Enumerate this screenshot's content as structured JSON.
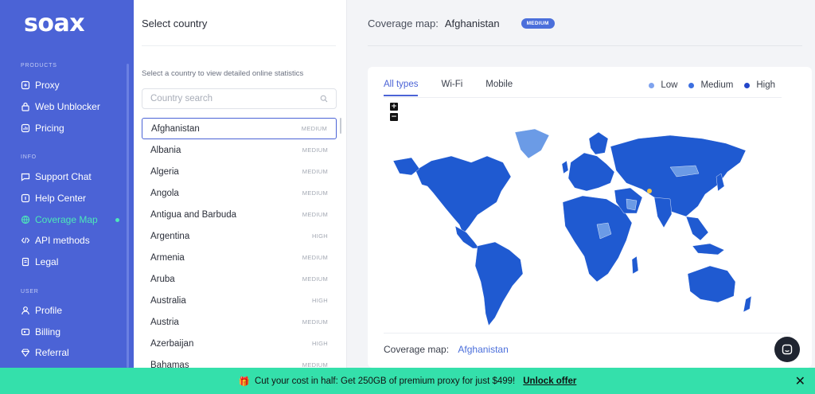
{
  "brand": {
    "logo": "soax"
  },
  "sidebar": {
    "sections": {
      "products": "PRODUCTS",
      "info": "INFO",
      "user": "USER"
    },
    "items": [
      {
        "label": "Proxy",
        "icon": "proxy-icon"
      },
      {
        "label": "Web Unblocker",
        "icon": "lock-icon"
      },
      {
        "label": "Pricing",
        "icon": "pricing-icon"
      },
      {
        "label": "Support Chat",
        "icon": "chat-icon"
      },
      {
        "label": "Help Center",
        "icon": "help-icon"
      },
      {
        "label": "Coverage Map",
        "icon": "globe-icon",
        "active": true
      },
      {
        "label": "API methods",
        "icon": "code-icon"
      },
      {
        "label": "Legal",
        "icon": "document-icon"
      },
      {
        "label": "Profile",
        "icon": "user-icon"
      },
      {
        "label": "Billing",
        "icon": "wallet-icon"
      },
      {
        "label": "Referral",
        "icon": "diamond-icon"
      }
    ]
  },
  "country_panel": {
    "title": "Select country",
    "hint": "Select a country to view detailed online statistics",
    "search_placeholder": "Country search",
    "countries": [
      {
        "name": "Afghanistan",
        "level": "MEDIUM",
        "selected": true
      },
      {
        "name": "Albania",
        "level": "MEDIUM"
      },
      {
        "name": "Algeria",
        "level": "MEDIUM"
      },
      {
        "name": "Angola",
        "level": "MEDIUM"
      },
      {
        "name": "Antigua and Barbuda",
        "level": "MEDIUM"
      },
      {
        "name": "Argentina",
        "level": "HIGH"
      },
      {
        "name": "Armenia",
        "level": "MEDIUM"
      },
      {
        "name": "Aruba",
        "level": "MEDIUM"
      },
      {
        "name": "Australia",
        "level": "HIGH"
      },
      {
        "name": "Austria",
        "level": "MEDIUM"
      },
      {
        "name": "Azerbaijan",
        "level": "HIGH"
      },
      {
        "name": "Bahamas",
        "level": "MEDIUM"
      }
    ]
  },
  "main": {
    "header_label": "Coverage map:",
    "header_country": "Afghanistan",
    "header_badge": "MEDIUM",
    "tabs": [
      {
        "label": "All types",
        "active": true
      },
      {
        "label": "Wi-Fi"
      },
      {
        "label": "Mobile"
      }
    ],
    "legend": [
      {
        "label": "Low",
        "color": "#7fa3ee"
      },
      {
        "label": "Medium",
        "color": "#3d6fe0"
      },
      {
        "label": "High",
        "color": "#2346c9"
      }
    ],
    "zoom_in": "+",
    "zoom_out": "−",
    "footer_label": "Coverage map:",
    "footer_country": "Afghanistan"
  },
  "promo": {
    "emoji": "🎁",
    "text": "Cut your cost in half: Get 250GB of premium proxy for just $499!",
    "link": "Unlock offer",
    "close": "✕"
  },
  "colors": {
    "sidebar_bg": "#4b63d6",
    "active_nav": "#4de8b8",
    "map_medium": "#1f5ad1",
    "map_low": "#6b9be6",
    "promo_bg": "#34e0ab"
  }
}
